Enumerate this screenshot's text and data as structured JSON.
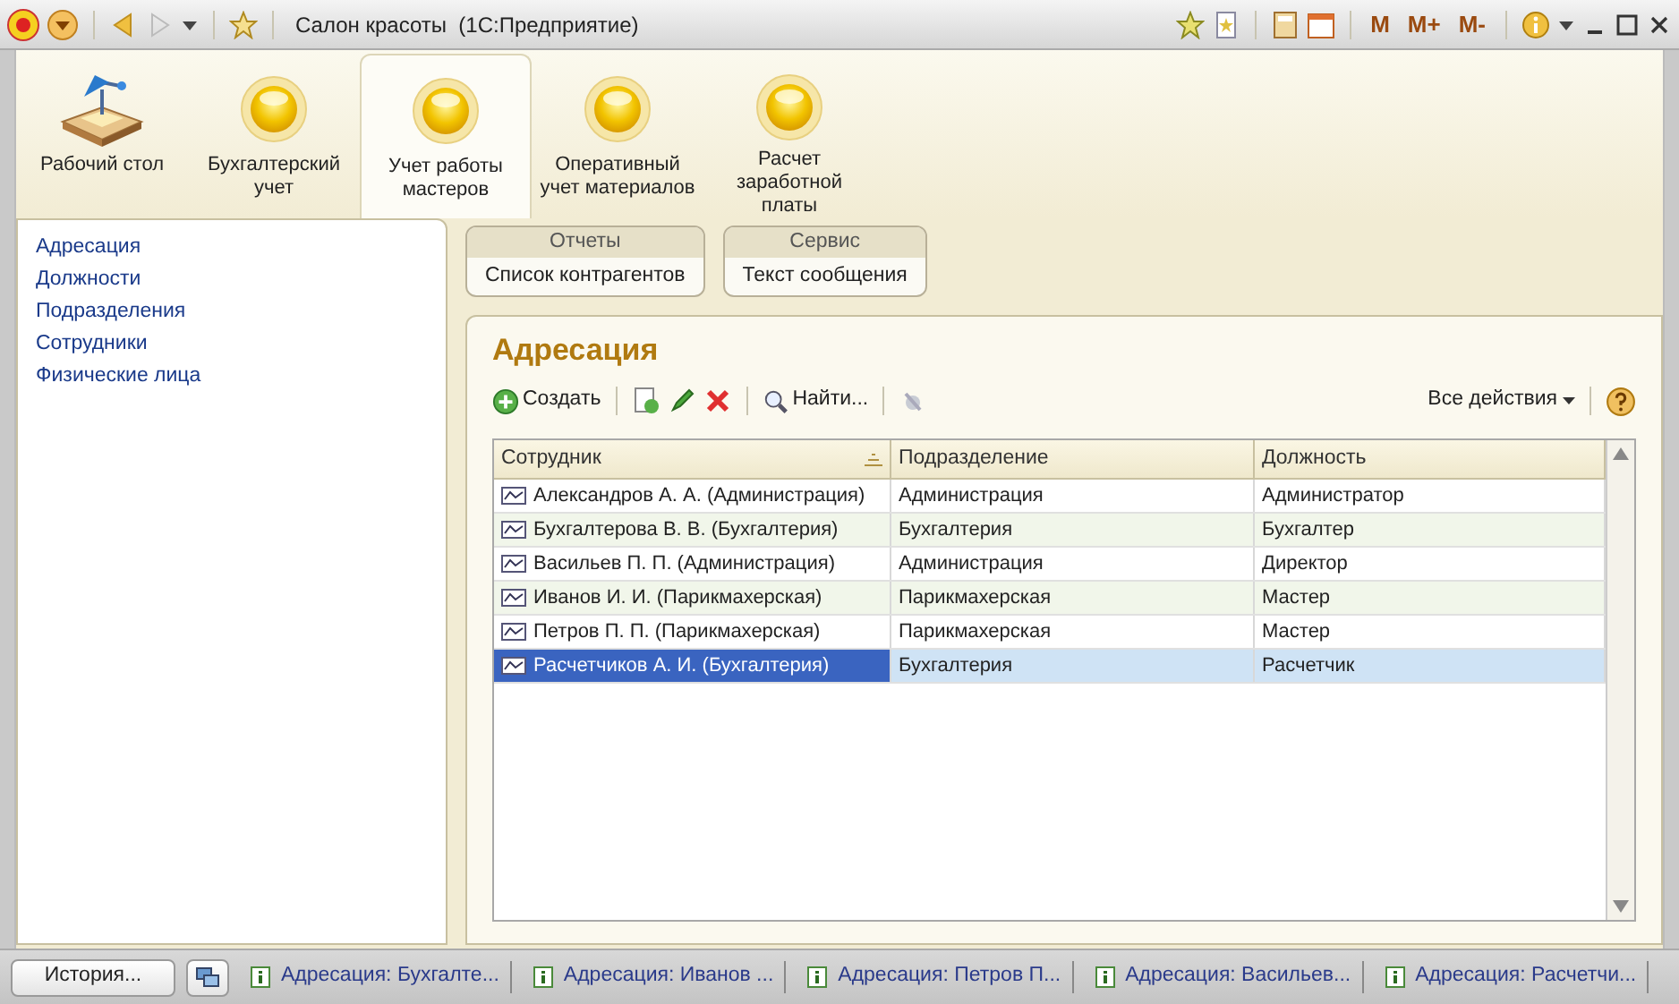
{
  "window": {
    "title": "Салон красоты  (1С:Предприятие)"
  },
  "toolbar_right": [
    "M",
    "M+",
    "M-"
  ],
  "sections": [
    {
      "label": "Рабочий стол",
      "kind": "desk",
      "selected": false
    },
    {
      "label": "Бухгалтерский учет",
      "kind": "section",
      "selected": false
    },
    {
      "label": "Учет работы мастеров",
      "kind": "section",
      "selected": true
    },
    {
      "label": "Оперативный учет материалов",
      "kind": "section",
      "selected": false
    },
    {
      "label": "Расчет заработной платы",
      "kind": "section",
      "selected": false
    }
  ],
  "sidebar": {
    "items": [
      "Адресация",
      "Должности",
      "Подразделения",
      "Сотрудники",
      "Физические лица"
    ]
  },
  "command_groups": [
    {
      "title": "Отчеты",
      "items": [
        "Список контрагентов"
      ]
    },
    {
      "title": "Сервис",
      "items": [
        "Текст сообщения"
      ]
    }
  ],
  "form": {
    "title": "Адресация",
    "create": "Создать",
    "find": "Найти...",
    "all_actions": "Все действия",
    "table": {
      "columns": [
        "Сотрудник",
        "Подразделение",
        "Должность"
      ],
      "rows": [
        {
          "cells": [
            "Александров А. А. (Администрация)",
            "Администрация",
            "Администратор"
          ],
          "selected": false
        },
        {
          "cells": [
            "Бухгалтерова В. В. (Бухгалтерия)",
            "Бухгалтерия",
            "Бухгалтер"
          ],
          "selected": false
        },
        {
          "cells": [
            "Васильев П. П. (Администрация)",
            "Администрация",
            "Директор"
          ],
          "selected": false
        },
        {
          "cells": [
            "Иванов И. И. (Парикмахерская)",
            "Парикмахерская",
            "Мастер"
          ],
          "selected": false
        },
        {
          "cells": [
            "Петров П. П. (Парикмахерская)",
            "Парикмахерская",
            "Мастер"
          ],
          "selected": false
        },
        {
          "cells": [
            "Расчетчиков А. И. (Бухгалтерия)",
            "Бухгалтерия",
            "Расчетчик"
          ],
          "selected": true
        }
      ]
    }
  },
  "status_bar": {
    "history": "История...",
    "windows": [
      "Адресация: Бухгалте...",
      "Адресация: Иванов ...",
      "Адресация: Петров П...",
      "Адресация: Васильев...",
      "Адресация: Расчетчи..."
    ]
  }
}
